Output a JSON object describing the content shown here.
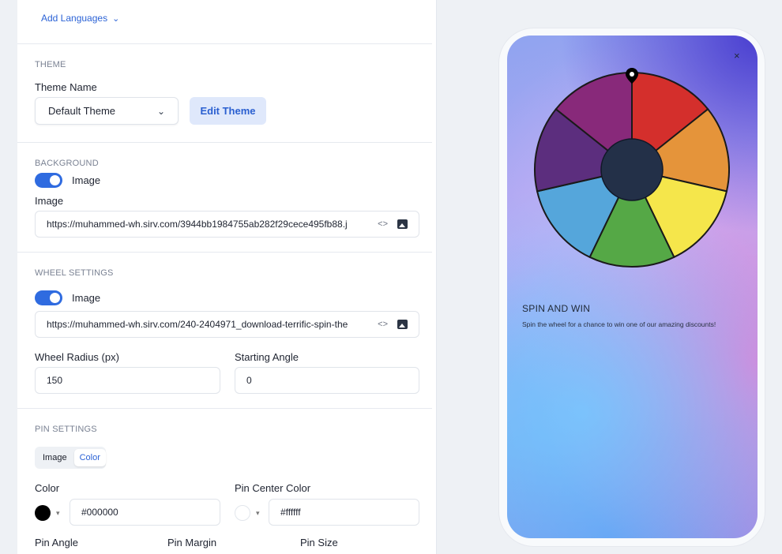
{
  "languages": {
    "add_label": "Add Languages"
  },
  "theme": {
    "section_title": "THEME",
    "name_label": "Theme Name",
    "selected": "Default Theme",
    "edit_button": "Edit Theme"
  },
  "background": {
    "section_title": "BACKGROUND",
    "toggle_label": "Image",
    "toggle_on": true,
    "image_label": "Image",
    "image_url": "https://muhammed-wh.sirv.com/3944bb1984755ab282f29cece495fb88.j"
  },
  "wheel_settings": {
    "section_title": "WHEEL SETTINGS",
    "toggle_label": "Image",
    "toggle_on": true,
    "image_url": "https://muhammed-wh.sirv.com/240-2404971_download-terrific-spin-the",
    "radius_label": "Wheel Radius (px)",
    "radius_value": "150",
    "angle_label": "Starting Angle",
    "angle_value": "0"
  },
  "pin_settings": {
    "section_title": "PIN SETTINGS",
    "mode_options": [
      "Image",
      "Color"
    ],
    "mode_selected": "Color",
    "color_label": "Color",
    "color_value": "#000000",
    "center_color_label": "Pin Center Color",
    "center_color_value": "#ffffff",
    "angle_label": "Pin Angle",
    "margin_label": "Pin Margin",
    "size_label": "Pin Size"
  },
  "preview": {
    "close_glyph": "×",
    "title": "SPIN AND WIN",
    "subtitle": "Spin the wheel for a chance to win one of our amazing discounts!",
    "segment_colors": [
      "#d42f2c",
      "#e5943a",
      "#f5e64b",
      "#55a846",
      "#55a6db",
      "#5c2e7e",
      "#88297a"
    ],
    "hub_color": "#233048"
  },
  "icons": {
    "chevron": "⌄",
    "code": "‹›"
  }
}
